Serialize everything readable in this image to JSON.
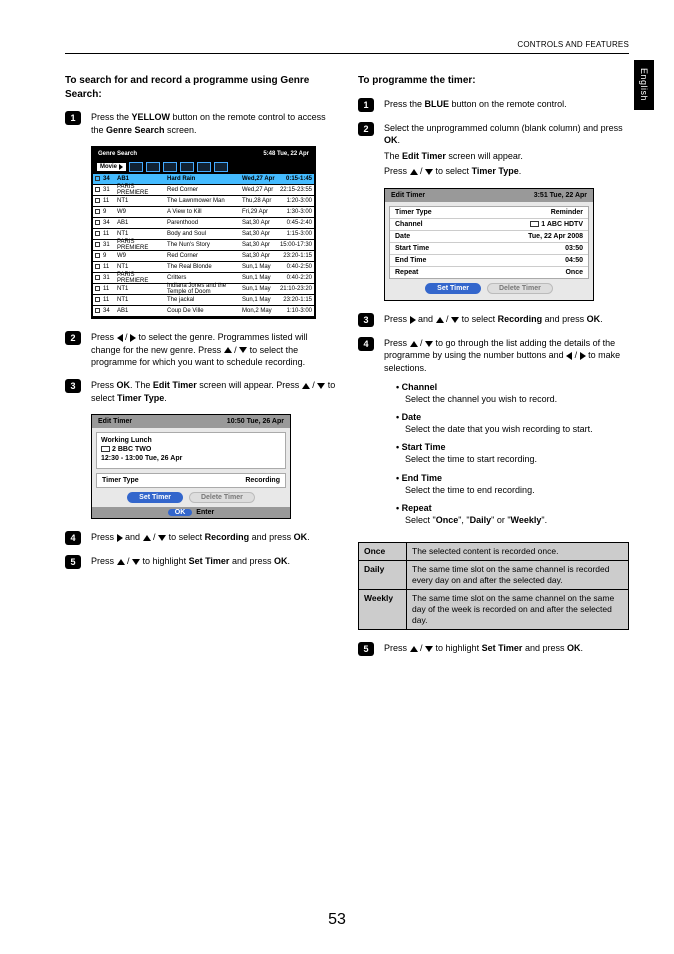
{
  "header": "CONTROLS AND FEATURES",
  "side_tab": "English",
  "page_number": "53",
  "left": {
    "heading": "To search for and record a programme using Genre Search:",
    "s1": {
      "pre": "Press the ",
      "btn": "YELLOW",
      "mid": " button on the remote control to access the ",
      "scr": "Genre Search",
      "post": " screen."
    },
    "s2": {
      "a": "Press ",
      "b": " to select the genre. Programmes listed will change for the new genre. Press ",
      "c": " to select the programme for which you want to schedule recording."
    },
    "s3": {
      "a": "Press ",
      "ok": "OK",
      "b": ". The ",
      "et": "Edit Timer",
      "c": " screen will appear. Press ",
      "d": " to select ",
      "tt": "Timer Type",
      "e": "."
    },
    "s4": {
      "a": "Press ",
      "b": " and ",
      "c": " to select ",
      "rec": "Recording",
      "d": " and press ",
      "ok": "OK",
      "e": "."
    },
    "s5": {
      "a": "Press ",
      "b": " to highlight ",
      "st": "Set Timer",
      "c": " and press ",
      "ok": "OK",
      "d": "."
    }
  },
  "genre_search": {
    "title": "Genre Search",
    "time": "5:48 Tue, 22 Apr",
    "movie": "Movie",
    "rows": [
      {
        "n": "34",
        "ch": "AB1",
        "t": "Hard Rain",
        "d": "Wed,27 Apr",
        "tm": "0:15-1:45",
        "hl": true
      },
      {
        "n": "31",
        "ch": "PARIS PREMIERE",
        "t": "Red Corner",
        "d": "Wed,27 Apr",
        "tm": "22:15-23:55"
      },
      {
        "n": "11",
        "ch": "NT1",
        "t": "The Lawnmower Man",
        "d": "Thu,28 Apr",
        "tm": "1:20-3:00"
      },
      {
        "n": "9",
        "ch": "W9",
        "t": "A View to Kill",
        "d": "Fri,29 Apr",
        "tm": "1:30-3:00"
      },
      {
        "n": "34",
        "ch": "AB1",
        "t": "Parenthood",
        "d": "Sat,30 Apr",
        "tm": "0:45-2:40"
      },
      {
        "n": "11",
        "ch": "NT1",
        "t": "Body and Soul",
        "d": "Sat,30 Apr",
        "tm": "1:15-3:00"
      },
      {
        "n": "31",
        "ch": "PARIS PREMIERE",
        "t": "The Nun's Story",
        "d": "Sat,30 Apr",
        "tm": "15:00-17:30"
      },
      {
        "n": "9",
        "ch": "W9",
        "t": "Red Corner",
        "d": "Sat,30 Apr",
        "tm": "23:20-1:15"
      },
      {
        "n": "11",
        "ch": "NT1",
        "t": "The Real Blonde",
        "d": "Sun,1 May",
        "tm": "0:40-2:50"
      },
      {
        "n": "31",
        "ch": "PARIS PREMIERE",
        "t": "Critters",
        "d": "Sun,1 May",
        "tm": "0:40-2:20"
      },
      {
        "n": "11",
        "ch": "NT1",
        "t": "Indiana Jones and the Temple of Doom",
        "d": "Sun,1 May",
        "tm": "21:10-23:20"
      },
      {
        "n": "11",
        "ch": "NT1",
        "t": "The jackal",
        "d": "Sun,1 May",
        "tm": "23:20-1:15"
      },
      {
        "n": "34",
        "ch": "AB1",
        "t": "Coup De Ville",
        "d": "Mon,2 May",
        "tm": "1:10-3:00"
      }
    ]
  },
  "edit_timer_left": {
    "title": "Edit Timer",
    "time": "10:50 Tue, 26 Apr",
    "prog": "Working Lunch",
    "ch": "2  BBC  TWO",
    "slot": "12:30 - 13:00 Tue, 26 Apr",
    "tt_label": "Timer Type",
    "tt_value": "Recording",
    "set": "Set Timer",
    "del": "Delete Timer",
    "ok": "OK",
    "enter": "Enter"
  },
  "right": {
    "heading": "To programme the timer:",
    "s1": {
      "a": "Press the ",
      "btn": "BLUE",
      "b": " button on the remote control."
    },
    "s2": {
      "a": "Select the unprogrammed column (blank column) and press ",
      "ok": "OK",
      "b": ".",
      "c": "The ",
      "et": "Edit Timer",
      "d": " screen will appear.",
      "e": "Press ",
      "f": " to select ",
      "tt": "Timer Type",
      "g": "."
    },
    "s3": {
      "a": "Press ",
      "b": " and ",
      "c": " to select ",
      "rec": "Recording",
      "d": " and press ",
      "ok": "OK",
      "e": "."
    },
    "s4": {
      "a": "Press ",
      "b": " to go through the list adding the details of the programme by using the number buttons and ",
      "c": " to make selections."
    },
    "s5": {
      "a": "Press ",
      "b": " to highlight ",
      "st": "Set Timer",
      "c": " and press ",
      "ok": "OK",
      "d": "."
    },
    "bullets": [
      {
        "t": "Channel",
        "d": "Select the channel you wish to record."
      },
      {
        "t": "Date",
        "d": "Select the date that you wish recording to start."
      },
      {
        "t": "Start Time",
        "d": "Select the time to start recording."
      },
      {
        "t": "End Time",
        "d": "Select the time to end recording."
      },
      {
        "t": "Repeat",
        "d_pre": "Select \"",
        "o1": "Once",
        "d_mid1": "\", \"",
        "o2": "Daily",
        "d_mid2": "\" or \"",
        "o3": "Weekly",
        "d_post": "\"."
      }
    ],
    "rtable": [
      {
        "h": "Once",
        "v": "The selected content is recorded once."
      },
      {
        "h": "Daily",
        "v": "The same time slot on the same channel is recorded every day on and after the selected day."
      },
      {
        "h": "Weekly",
        "v": "The same time slot on the same channel on the same day of the week is recorded on and after the selected day."
      }
    ]
  },
  "edit_timer_right": {
    "title": "Edit Timer",
    "time": "3:51 Tue, 22 Apr",
    "rows": [
      {
        "l": "Timer Type",
        "v": "Reminder"
      },
      {
        "l": "Channel",
        "v": "1 ABC HDTV",
        "icon": true
      },
      {
        "l": "Date",
        "v": "Tue, 22 Apr 2008"
      },
      {
        "l": "Start Time",
        "v": "03:50"
      },
      {
        "l": "End Time",
        "v": "04:50"
      },
      {
        "l": "Repeat",
        "v": "Once"
      }
    ],
    "set": "Set Timer",
    "del": "Delete Timer"
  }
}
